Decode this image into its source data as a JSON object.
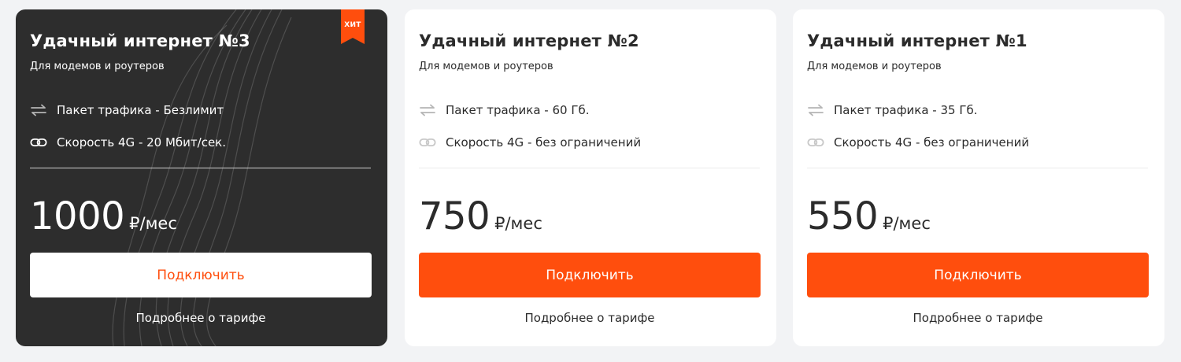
{
  "colors": {
    "accent": "#ff4e0d",
    "dark_card": "#2d2d2d",
    "light_card": "#ffffff",
    "page_bg": "#f2f3f5",
    "icon_muted": "#b5b5b5"
  },
  "cards": [
    {
      "title": "Удачный интернет №3",
      "subtitle": "Для модемов и роутеров",
      "badge": "ХИТ",
      "features": [
        {
          "icon": "transfer-arrows-icon",
          "text": "Пакет трафика - Безлимит"
        },
        {
          "icon": "link-chain-icon",
          "text": "Скорость 4G - 20 Мбит/сек."
        }
      ],
      "price": "1000",
      "price_unit": "₽/мес",
      "button_label": "Подключить",
      "details_link": "Подробнее о тарифе"
    },
    {
      "title": "Удачный интернет №2",
      "subtitle": "Для модемов и роутеров",
      "features": [
        {
          "icon": "transfer-arrows-icon",
          "text": "Пакет трафика - 60 Гб."
        },
        {
          "icon": "link-chain-icon",
          "text": "Скорость 4G - без ограничений"
        }
      ],
      "price": "750",
      "price_unit": "₽/мес",
      "button_label": "Подключить",
      "details_link": "Подробнее о тарифе"
    },
    {
      "title": "Удачный интернет №1",
      "subtitle": "Для модемов и роутеров",
      "features": [
        {
          "icon": "transfer-arrows-icon",
          "text": "Пакет трафика - 35 Гб."
        },
        {
          "icon": "link-chain-icon",
          "text": "Скорость 4G - без ограничений"
        }
      ],
      "price": "550",
      "price_unit": "₽/мес",
      "button_label": "Подключить",
      "details_link": "Подробнее о тарифе"
    }
  ]
}
